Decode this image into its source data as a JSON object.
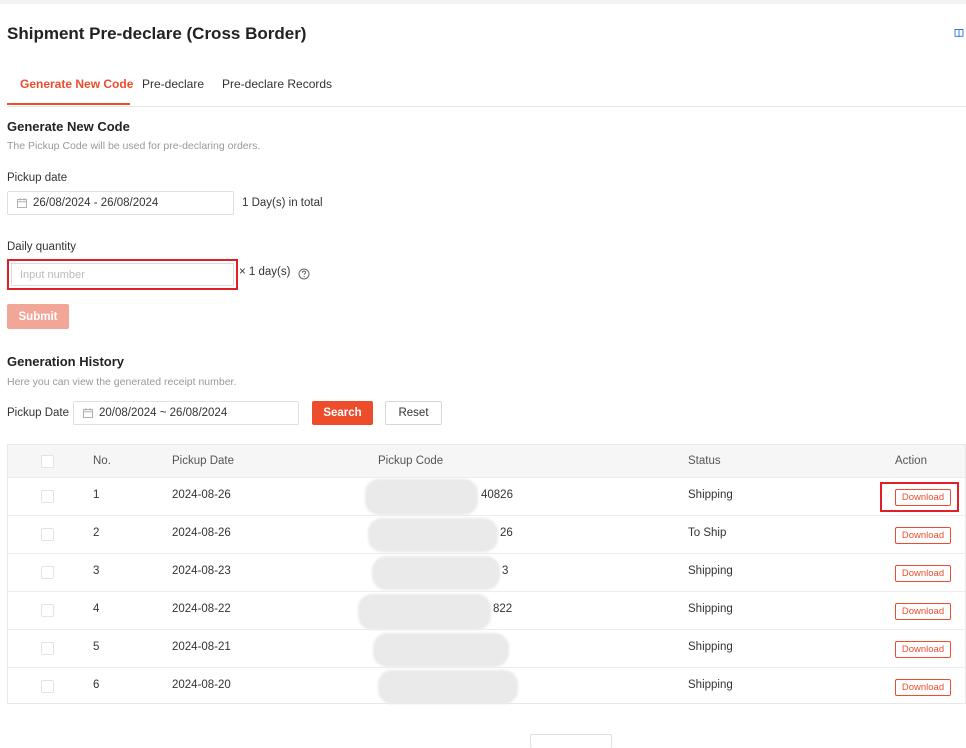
{
  "page": {
    "title": "Shipment Pre-declare (Cross Border)"
  },
  "tabs": [
    {
      "label": "Generate New Code",
      "active": true
    },
    {
      "label": "Pre-declare",
      "active": false
    },
    {
      "label": "Pre-declare Records",
      "active": false
    }
  ],
  "generate": {
    "title": "Generate New Code",
    "description": "The Pickup Code will be used for pre-declaring orders.",
    "pickup_date_label": "Pickup date",
    "pickup_date_value": "26/08/2024 - 26/08/2024",
    "days_total": "1 Day(s) in total",
    "daily_quantity_label": "Daily quantity",
    "quantity_placeholder": "Input number",
    "quantity_value": "",
    "multiplier": "× 1 day(s)",
    "submit_label": "Submit"
  },
  "history": {
    "title": "Generation History",
    "description": "Here you can view the generated receipt number.",
    "filter_label": "Pickup Date",
    "filter_value": "20/08/2024 ~ 26/08/2024",
    "search_label": "Search",
    "reset_label": "Reset",
    "columns": [
      "No.",
      "Pickup Date",
      "Pickup Code",
      "Status",
      "Action"
    ],
    "rows": [
      {
        "no": "1",
        "date": "2024-08-26",
        "code": "40826",
        "status": "Shipping",
        "action": "Download"
      },
      {
        "no": "2",
        "date": "2024-08-26",
        "code": "26",
        "status": "To Ship",
        "action": "Download"
      },
      {
        "no": "3",
        "date": "2024-08-23",
        "code": "3",
        "status": "Shipping",
        "action": "Download"
      },
      {
        "no": "4",
        "date": "2024-08-22",
        "code": "822",
        "status": "Shipping",
        "action": "Download"
      },
      {
        "no": "5",
        "date": "2024-08-21",
        "code": "",
        "status": "Shipping",
        "action": "Download"
      },
      {
        "no": "6",
        "date": "2024-08-20",
        "code": "",
        "status": "Shipping",
        "action": "Download"
      }
    ]
  },
  "colors": {
    "accent": "#ee4d2d",
    "highlight": "#e01f26",
    "submit_disabled": "#f2a697"
  },
  "icons": {
    "calendar": "calendar-icon",
    "help": "question-circle-icon",
    "corner": "book-icon"
  }
}
